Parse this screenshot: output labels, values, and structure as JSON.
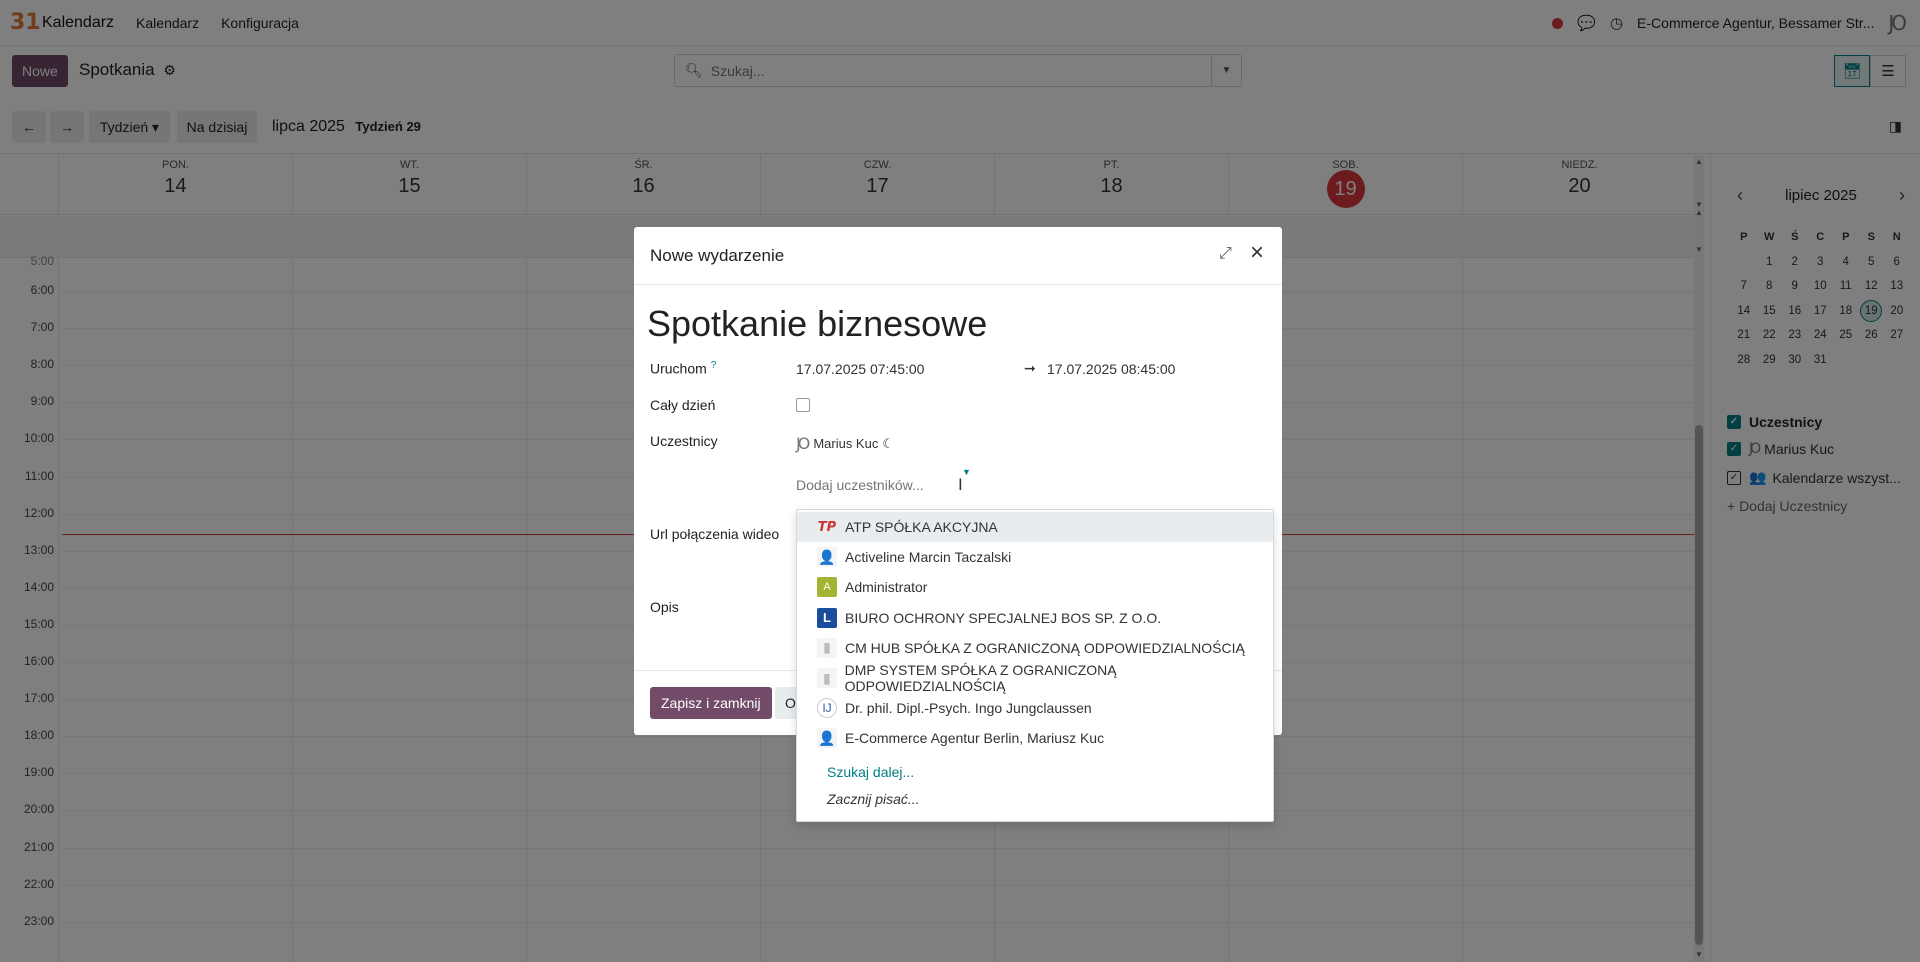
{
  "navbar": {
    "app_logo": "31",
    "app_name": "Kalendarz",
    "menus": [
      "Kalendarz",
      "Konfiguracja"
    ],
    "company": "E-Commerce Agentur, Bessamer Str...",
    "user_logo": "JO",
    "icons": [
      "record-dot-icon",
      "chat-icon",
      "clock-icon"
    ],
    "record_color": "#d9363e"
  },
  "control": {
    "new_label": "Nowe",
    "breadcrumb": "Spotkania",
    "search_placeholder": "Szukaj...",
    "scale_label": "Tydzień ▾",
    "today_label": "Na dzisiaj",
    "period": "lipca 2025",
    "week": "Tydzień 29"
  },
  "calendar": {
    "days": [
      {
        "name": "PON.",
        "num": "14"
      },
      {
        "name": "WT.",
        "num": "15"
      },
      {
        "name": "ŚR.",
        "num": "16"
      },
      {
        "name": "CZW.",
        "num": "17"
      },
      {
        "name": "PT.",
        "num": "18"
      },
      {
        "name": "SOB.",
        "num": "19"
      },
      {
        "name": "NIEDZ.",
        "num": "20"
      }
    ],
    "today_color": "#d9363e",
    "partial_hour": "5:00",
    "hours": [
      "6:00",
      "7:00",
      "8:00",
      "9:00",
      "10:00",
      "11:00",
      "12:00",
      "13:00",
      "14:00",
      "15:00",
      "16:00",
      "17:00",
      "18:00",
      "19:00",
      "20:00",
      "21:00",
      "22:00",
      "23:00"
    ]
  },
  "side_panel": {
    "month_title": "lipiec 2025",
    "weekday_headers": [
      "P",
      "W",
      "Ś",
      "C",
      "P",
      "S",
      "N"
    ],
    "weeks": [
      [
        "",
        "1",
        "2",
        "3",
        "4",
        "5",
        "6"
      ],
      [
        "7",
        "8",
        "9",
        "10",
        "11",
        "12",
        "13"
      ],
      [
        "14",
        "15",
        "16",
        "17",
        "18",
        "19",
        "20"
      ],
      [
        "21",
        "22",
        "23",
        "24",
        "25",
        "26",
        "27"
      ],
      [
        "28",
        "29",
        "30",
        "31",
        "",
        "",
        ""
      ]
    ],
    "selected_day": "19",
    "filter_title": "Uczestnicy",
    "filter_person": "Marius Kuc",
    "filter_all": "Kalendarze wszyst...",
    "add_attendee": "+ Dodaj Uczestnicy",
    "accent_color": "#017e84"
  },
  "modal": {
    "title": "Nowe wydarzenie",
    "event_name": "Spotkanie biznesowe",
    "start_label": "Uruchom",
    "start_help": "?",
    "start_value": "17.07.2025 07:45:00",
    "end_arrow": "➞",
    "end_value": "17.07.2025 08:45:00",
    "allday_label": "Cały dzień",
    "attendees_label": "Uczestnicy",
    "attendee_name": "Marius Kuc",
    "attendee_status": "☾",
    "attendee_logo": "JO",
    "add_attendees_placeholder": "Dodaj uczestników...",
    "video_label": "Url połączenia wideo",
    "desc_label": "Opis",
    "save_label": "Zapisz i zamknij",
    "discard_label": "O",
    "brand_color": "#714b67"
  },
  "dropdown": {
    "items": [
      {
        "name": "ATP SPÓŁKA AKCYJNA",
        "avatar": "TP",
        "icon": "tp-logo-icon"
      },
      {
        "name": "Activeline Marcin Taczalski",
        "avatar": "👤",
        "icon": "person-avatar-icon"
      },
      {
        "name": "Administrator",
        "avatar": "A",
        "icon": "letter-a-avatar-icon"
      },
      {
        "name": "BIURO OCHRONY SPECJALNEJ BOS SP. Z O.O.",
        "avatar": "L",
        "icon": "letter-l-logo-icon"
      },
      {
        "name": "CM HUB SPÓŁKA Z OGRANICZONĄ ODPOWIEDZIALNOŚCIĄ",
        "avatar": "▮",
        "icon": "building-avatar-icon"
      },
      {
        "name": "DMP SYSTEM SPÓŁKA Z OGRANICZONĄ ODPOWIEDZIALNOŚCIĄ",
        "avatar": "▮",
        "icon": "building-avatar-icon"
      },
      {
        "name": "Dr. phil. Dipl.-Psych. Ingo Jungclaussen",
        "avatar": "IJ",
        "icon": "ij-logo-icon"
      },
      {
        "name": "E-Commerce Agentur Berlin, Mariusz Kuc",
        "avatar": "👤",
        "icon": "person-avatar-icon"
      }
    ],
    "more_label": "Szukaj dalej...",
    "typing_label": "Zacznij pisać..."
  }
}
